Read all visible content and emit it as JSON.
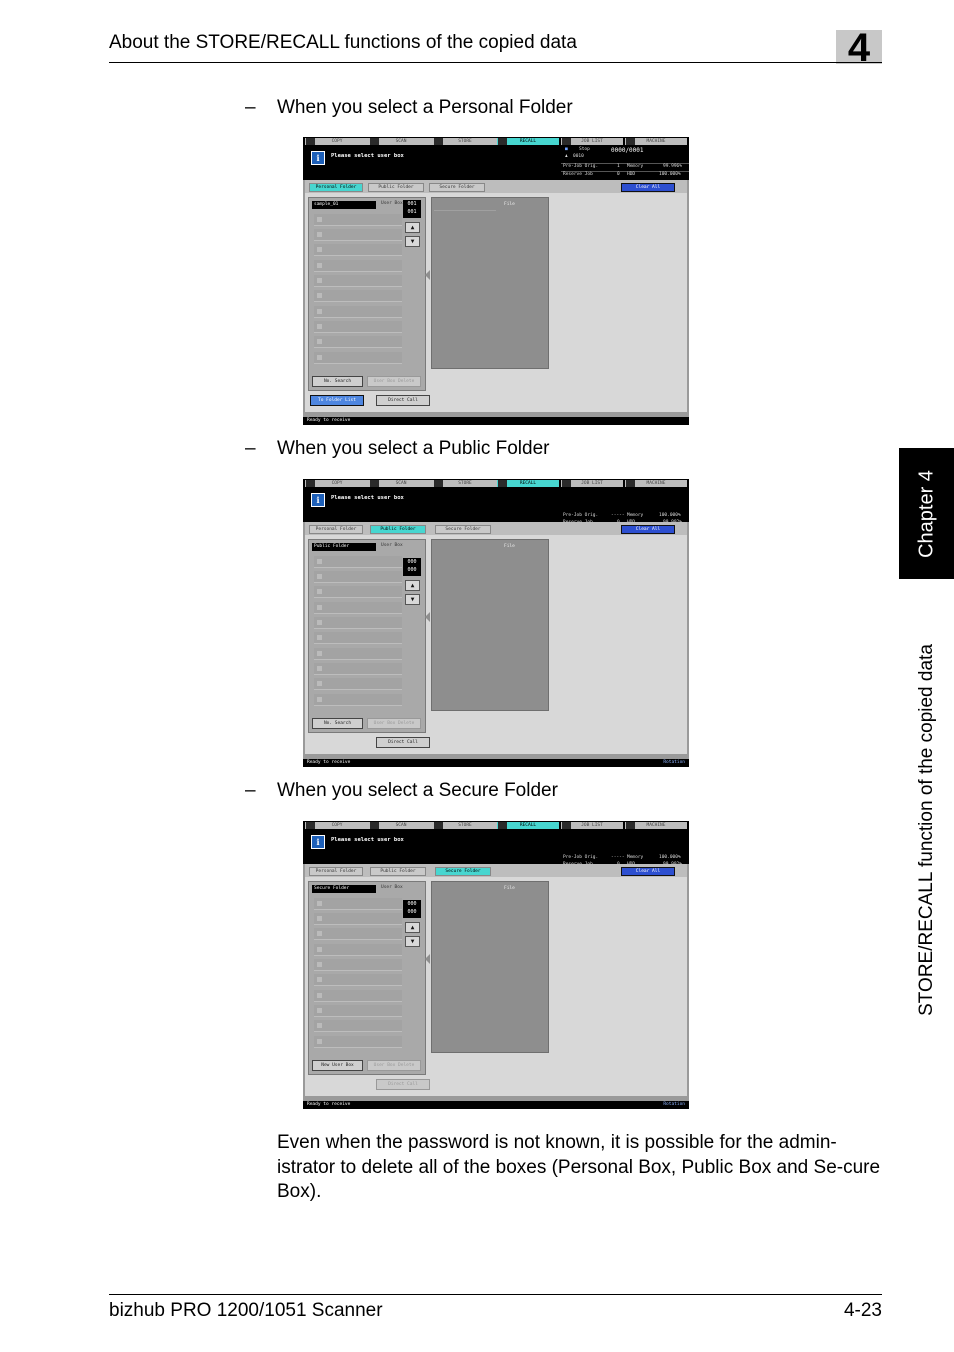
{
  "header": {
    "title": "About the STORE/RECALL functions of the copied data",
    "chapter_number": "4"
  },
  "side": {
    "chapter_label": "Chapter 4",
    "section_label": "STORE/RECALL function of the copied data"
  },
  "captions": {
    "personal": "When you select a Personal Folder",
    "public": "When you select a Public Folder",
    "secure": "When you select a Secure Folder",
    "dash": "–"
  },
  "body_paragraph": "Even when the password is not known, it is possible for the admin-istrator to delete all of the boxes (Personal Box, Public Box and Se-cure Box).",
  "footer": {
    "product": "bizhub PRO 1200/1051 Scanner",
    "page": "4-23"
  },
  "screen_common": {
    "tabs": [
      "COPY",
      "SCAN",
      "STORE",
      "RECALL",
      "JOB LIST",
      "MACHINE"
    ],
    "active_tab": "RECALL",
    "message": "Please select user box",
    "folder_tabs": [
      "Personal Folder",
      "Public Folder",
      "Secure Folder"
    ],
    "clear_all": "Clear All",
    "user_box_header": "User Box",
    "file_header": "File",
    "user_box_delete": "User Box Delete",
    "direct_call": "Direct Call",
    "status": "Ready to receive",
    "rotation": "Rotation"
  },
  "screens": {
    "personal": {
      "folder_field": "sample_01",
      "counter_top": "001",
      "counter_bottom": "001",
      "left_button": "No. Search",
      "folder_list": "To Folder List",
      "stop": "Stop",
      "job_count": "0000/0001",
      "user_id": "0010",
      "stat_pre_job": "Pre-Job Orig.",
      "stat_pre_val": "1",
      "stat_mem": "Memory",
      "stat_mem_val": "99.996%",
      "stat_res_job": "Reserve Job",
      "stat_res_val": "0",
      "stat_hdd": "HDD",
      "stat_hdd_val": "100.000%"
    },
    "public": {
      "folder_field": "Public Folder",
      "counter_top": "000",
      "counter_bottom": "000",
      "left_button": "No. Search",
      "stat_pre_job": "Pre-Job Orig.",
      "stat_pre_val": "-----",
      "stat_mem": "Memory",
      "stat_mem_val": "100.000%",
      "stat_res_job": "Reserve Job",
      "stat_res_val": "0",
      "stat_hdd": "HDD",
      "stat_hdd_val": "99.992%"
    },
    "secure": {
      "folder_field": "Secure Folder",
      "counter_top": "000",
      "counter_bottom": "000",
      "left_button": "New User Box",
      "stat_pre_job": "Pre-Job Orig.",
      "stat_pre_val": "-----",
      "stat_mem": "Memory",
      "stat_mem_val": "100.000%",
      "stat_res_job": "Reserve Job",
      "stat_res_val": "0",
      "stat_hdd": "HDD",
      "stat_hdd_val": "99.992%"
    }
  }
}
